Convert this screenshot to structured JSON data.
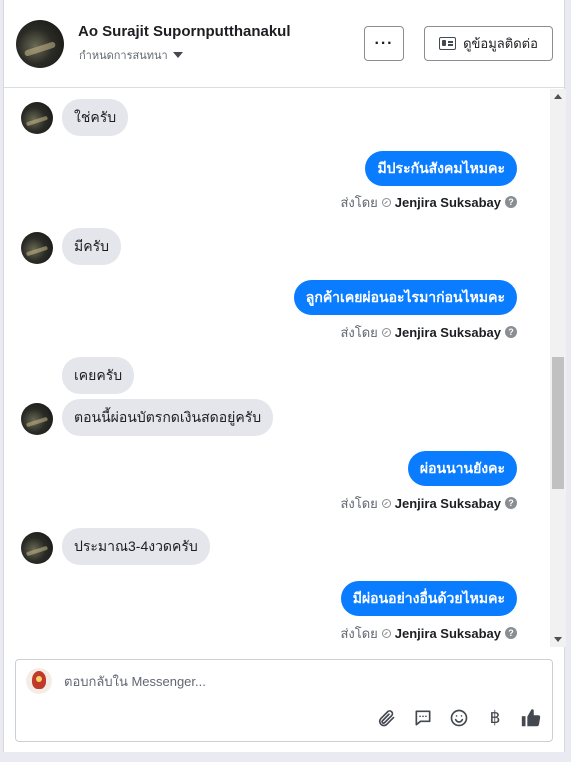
{
  "header": {
    "name": "Ao Surajit Supornputthanakul",
    "assign_label": "กำหนดการสนทนา",
    "more_label": "···",
    "contact_label": "ดูข้อมูลติดต่อ"
  },
  "messages": {
    "in_1": "ใช่ครับ",
    "out_1": "มีประกันสังคมไหมคะ",
    "in_2": "มีครับ",
    "out_2": "ลูกค้าเคยผ่อนอะไรมาก่อนไหมคะ",
    "in_3": "เคยครับ",
    "in_4": "ตอนนี้ผ่อนบัตรกดเงินสดอยู่ครับ",
    "out_3": "ผ่อนนานยังคะ",
    "in_5": "ประมาณ3-4งวดครับ",
    "out_4": "มีผ่อนอย่างอื่นด้วยไหมคะ"
  },
  "sent_by": {
    "label": "ส่งโดย",
    "agent": "Jenjira Suksabay",
    "help": "?"
  },
  "composer": {
    "placeholder": "ตอบกลับใน Messenger...",
    "currency_symbol": "฿"
  },
  "colors": {
    "accent": "#0a7cff",
    "incoming_bubble": "#e4e6eb"
  }
}
